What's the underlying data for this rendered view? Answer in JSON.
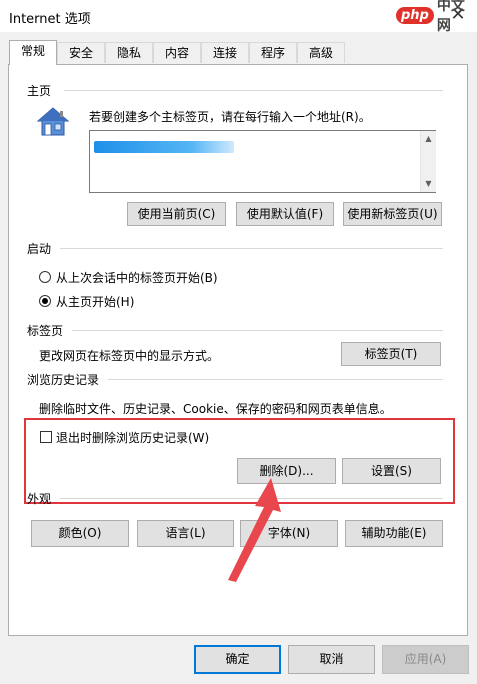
{
  "window": {
    "title": "Internet 选项",
    "close_glyph": "✕"
  },
  "watermark": {
    "logo": "php",
    "text": "中文网"
  },
  "tabs": [
    {
      "label": "常规",
      "active": true
    },
    {
      "label": "安全"
    },
    {
      "label": "隐私"
    },
    {
      "label": "内容"
    },
    {
      "label": "连接"
    },
    {
      "label": "程序"
    },
    {
      "label": "高级"
    }
  ],
  "home": {
    "title": "主页",
    "description": "若要创建多个主标签页，请在每行输入一个地址(R)。",
    "url_value": "",
    "icon": "house-icon",
    "buttons": {
      "use_current": "使用当前页(C)",
      "use_default": "使用默认值(F)",
      "use_new_tab": "使用新标签页(U)"
    }
  },
  "startup": {
    "title": "启动",
    "option_last_session": "从上次会话中的标签页开始(B)",
    "option_home_page": "从主页开始(H)",
    "selected": "home_page"
  },
  "tabs_section": {
    "title": "标签页",
    "description": "更改网页在标签页中的显示方式。",
    "button": "标签页(T)"
  },
  "history": {
    "title": "浏览历史记录",
    "description": "删除临时文件、历史记录、Cookie、保存的密码和网页表单信息。",
    "checkbox_label": "退出时删除浏览历史记录(W)",
    "checkbox_checked": false,
    "delete_button": "删除(D)...",
    "settings_button": "设置(S)"
  },
  "appearance": {
    "title": "外观",
    "colors_button": "颜色(O)",
    "languages_button": "语言(L)",
    "fonts_button": "字体(N)",
    "accessibility_button": "辅助功能(E)"
  },
  "footer": {
    "ok": "确定",
    "cancel": "取消",
    "apply": "应用(A)"
  },
  "colors": {
    "highlight": "#e0353d",
    "arrow": "#e8474d",
    "default_button_border": "#0078d7"
  }
}
